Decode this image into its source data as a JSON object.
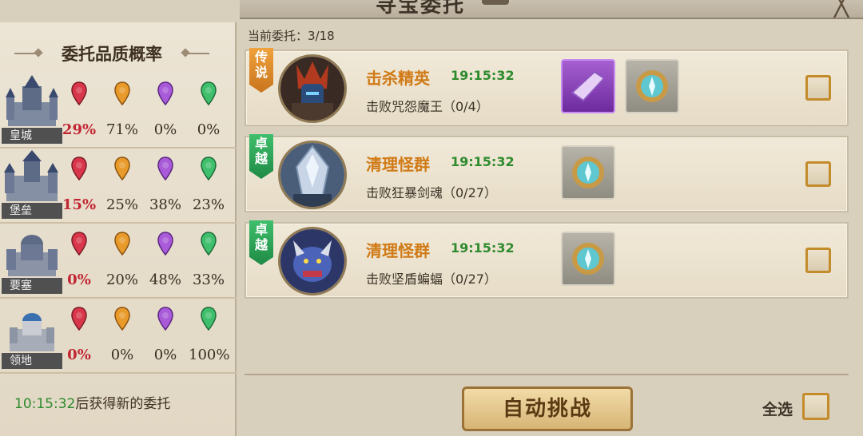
{
  "header": {
    "title": "寻宝委托"
  },
  "quality_panel": {
    "title": "委托品质概率",
    "rows": [
      {
        "building": "皇城",
        "rates": [
          "29%",
          "71%",
          "0%",
          "0%"
        ]
      },
      {
        "building": "堡垒",
        "rates": [
          "15%",
          "25%",
          "38%",
          "23%"
        ]
      },
      {
        "building": "要塞",
        "rates": [
          "0%",
          "20%",
          "48%",
          "33%"
        ]
      },
      {
        "building": "领地",
        "rates": [
          "0%",
          "0%",
          "0%",
          "100%"
        ]
      }
    ],
    "pin_colors": [
      "#d8364a",
      "#e89a2a",
      "#a85ad8",
      "#3fbf6c"
    ],
    "refresh_time": "10:15:32",
    "refresh_text": "后获得新的委托"
  },
  "commissions": {
    "current_label": "当前委托：3/18",
    "tasks": [
      {
        "rank": "传说",
        "name": "击杀精英",
        "time": "19:15:32",
        "desc": "击败咒怨魔王（0/4）",
        "rewards": [
          "purple-crystal-icon",
          "teal-gem-icon"
        ]
      },
      {
        "rank": "卓越",
        "name": "清理怪群",
        "time": "19:15:32",
        "desc": "击败狂暴剑魂（0/27）",
        "rewards": [
          "teal-gem-icon"
        ]
      },
      {
        "rank": "卓越",
        "name": "清理怪群",
        "time": "19:15:32",
        "desc": "击败坚盾蝙蝠（0/27）",
        "rewards": [
          "teal-gem-icon"
        ]
      }
    ]
  },
  "footer": {
    "auto_button": "自动挑战",
    "select_all": "全选"
  }
}
